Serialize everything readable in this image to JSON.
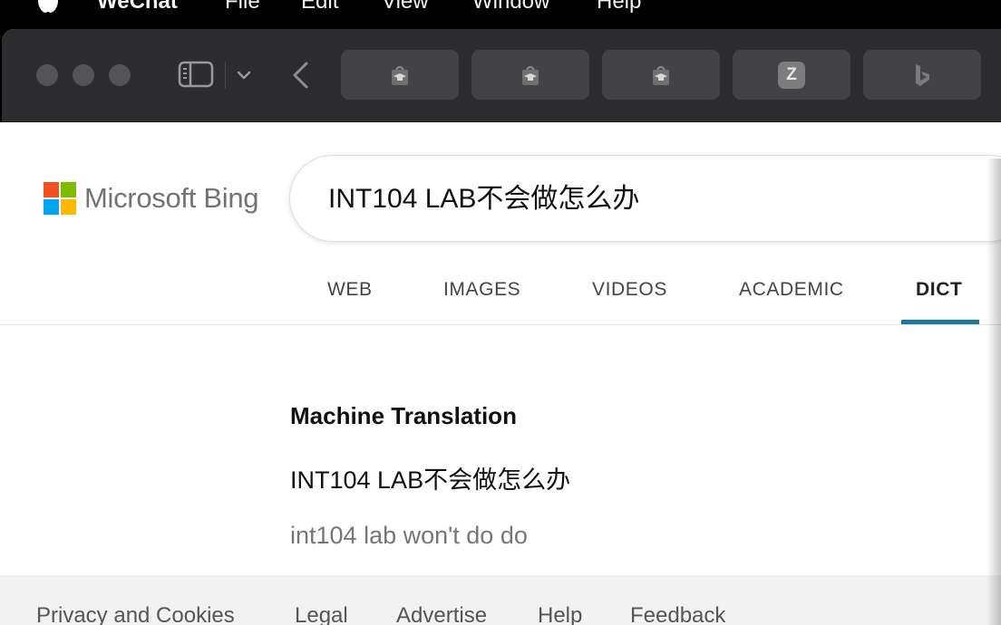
{
  "menubar": {
    "app": "WeChat",
    "items": [
      "File",
      "Edit",
      "View",
      "Window",
      "Help"
    ]
  },
  "toolbar": {
    "tabs": [
      {
        "icon": "graduation-bag-icon"
      },
      {
        "icon": "graduation-bag-icon"
      },
      {
        "icon": "graduation-bag-icon"
      },
      {
        "icon": "z-letter-icon",
        "glyph": "Z"
      },
      {
        "icon": "bing-logo-icon"
      }
    ]
  },
  "header": {
    "brand": "Microsoft Bing",
    "search_query": "INT104 LAB不会做怎么办"
  },
  "nav": {
    "tabs": [
      {
        "label": "WEB"
      },
      {
        "label": "IMAGES"
      },
      {
        "label": "VIDEOS"
      },
      {
        "label": "ACADEMIC"
      },
      {
        "label": "DICT",
        "active": true
      }
    ]
  },
  "translation": {
    "title": "Machine Translation",
    "source": "INT104 LAB不会做怎么办",
    "result": "int104 lab won't do do"
  },
  "footer": {
    "links": [
      "Privacy and Cookies",
      "Legal",
      "Advertise",
      "Help",
      "Feedback"
    ]
  },
  "colors": {
    "accent": "#17799b",
    "titlebar": "#2c2c2e",
    "logo_red": "#f25022",
    "logo_green": "#7fba00",
    "logo_blue": "#00a4ef",
    "logo_yellow": "#ffb900"
  }
}
